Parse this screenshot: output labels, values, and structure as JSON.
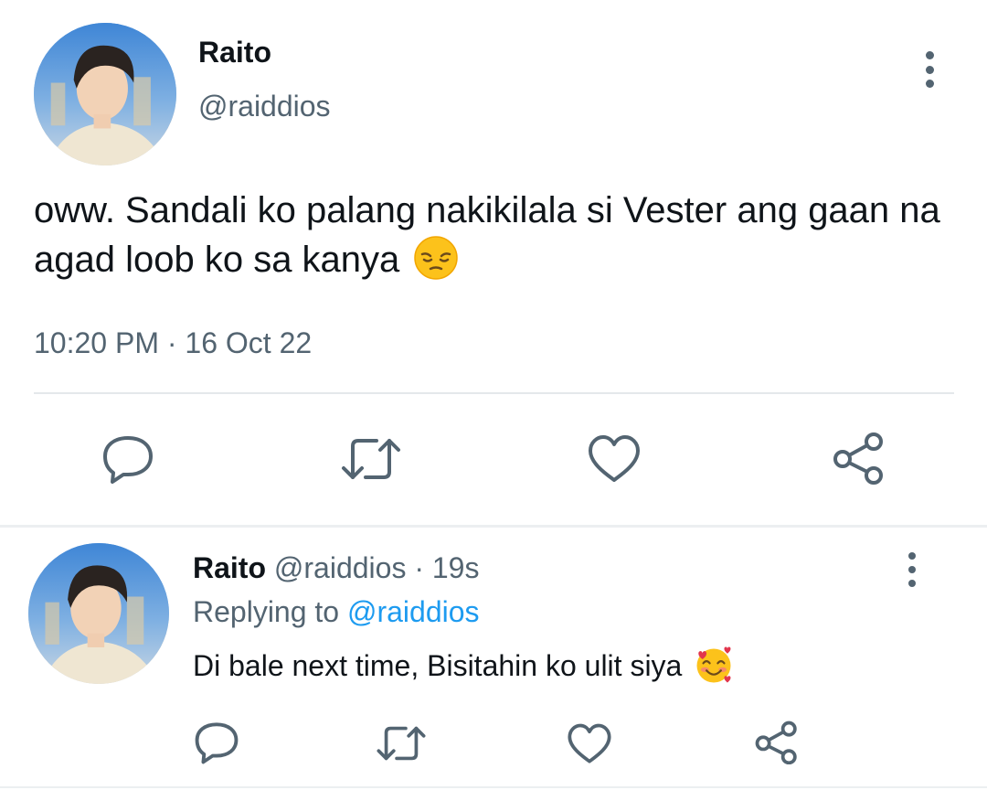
{
  "main_tweet": {
    "author_name": "Raito",
    "author_handle": "@raiddios",
    "text": "oww. Sandali ko palang nakikilala si Vester ang gaan na agad loob ko sa kanya",
    "emoji": "pensive-face",
    "time": "10:20 PM",
    "separator": "·",
    "date": "16 Oct 22",
    "actions": [
      "reply-icon",
      "retweet-icon",
      "like-icon",
      "share-icon"
    ]
  },
  "reply_tweet": {
    "author_name": "Raito",
    "author_handle": "@raiddios",
    "separator": "·",
    "age": "19s",
    "replying_label": "Replying to",
    "replying_to": "@raiddios",
    "text": "Di bale next time, Bisitahin ko ulit siya",
    "emoji": "smiling-face-with-hearts",
    "actions": [
      "reply-icon",
      "retweet-icon",
      "like-icon",
      "share-icon"
    ]
  },
  "colors": {
    "text_primary": "#0f1419",
    "text_secondary": "#536471",
    "link": "#1d9bf0",
    "divider": "#e4e8eb",
    "icon": "#536471"
  }
}
